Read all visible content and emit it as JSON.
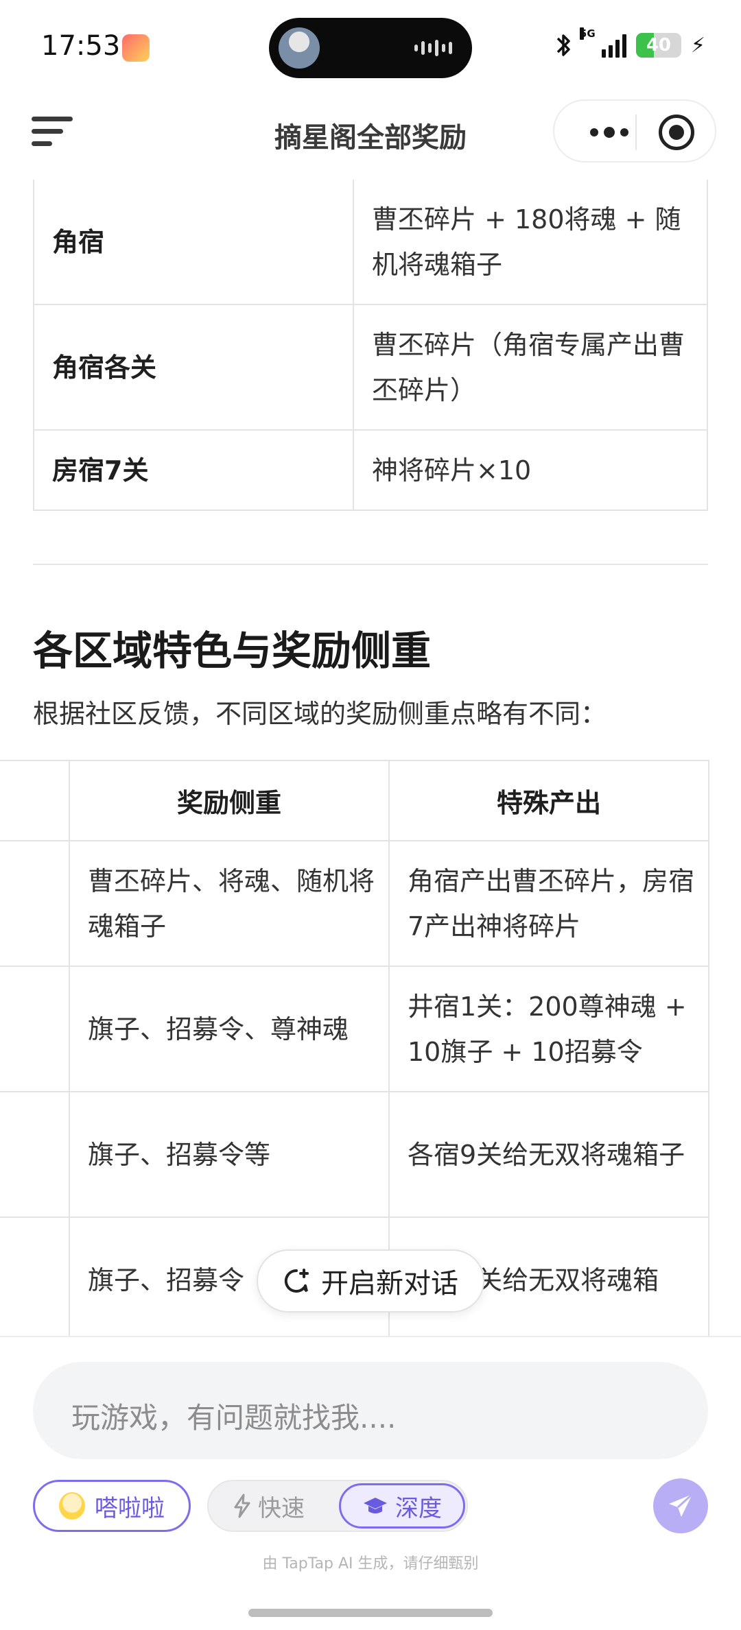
{
  "status_bar": {
    "time": "17:53",
    "network": "5G",
    "battery_text": "40",
    "battery_level": 0.4
  },
  "header": {
    "title": "摘星阁全部奖励"
  },
  "table1": {
    "rows": [
      {
        "name": "角宿",
        "reward": "曹丕碎片 + 180将魂 + 随机将魂箱子"
      },
      {
        "name": "角宿各关",
        "reward": "曹丕碎片（角宿专属产出曹丕碎片）"
      },
      {
        "name": "房宿7关",
        "reward": "神将碎片×10"
      }
    ]
  },
  "section": {
    "title": "各区域特色与奖励侧重",
    "description": "根据社区反馈，不同区域的奖励侧重点略有不同："
  },
  "table2": {
    "headers": [
      "",
      "奖励侧重",
      "特殊产出"
    ],
    "rows": [
      {
        "focus": "曹丕碎片、将魂、随机将魂箱子",
        "special": "角宿产出曹丕碎片，房宿7产出神将碎片"
      },
      {
        "focus": "旗子、招募令、尊神魂",
        "special": "井宿1关：200尊神魂 + 10旗子 + 10招募令"
      },
      {
        "focus": "旗子、招募令等",
        "special": "各宿9关给无双将魂箱子"
      },
      {
        "focus": "旗子、招募令",
        "special": "各宿9关给无双将魂箱"
      }
    ]
  },
  "new_chat_button": {
    "label": "开启新对话"
  },
  "composer": {
    "placeholder": "玩游戏，有问题就找我....",
    "persona_label": "嗒啦啦",
    "mode_fast": "快速",
    "mode_deep": "深度",
    "footer_note": "由 TapTap AI 生成，请仔细甄别"
  },
  "colors": {
    "accent": "#7c6cf0",
    "send_button": "#b7aef5",
    "battery": "#3cc14b"
  }
}
